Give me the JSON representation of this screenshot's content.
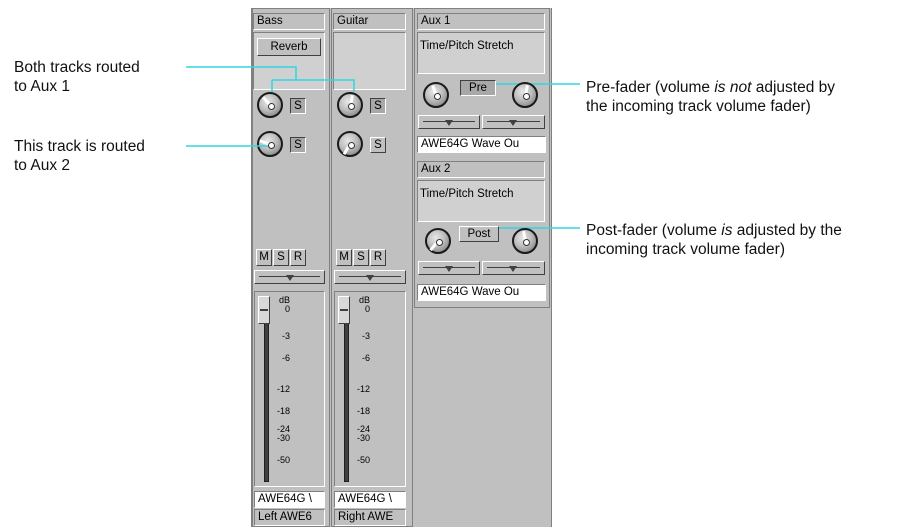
{
  "annotations": {
    "both_routed": [
      "Both tracks routed",
      "to Aux 1"
    ],
    "routed_aux2": [
      "This track is routed",
      "to Aux 2"
    ],
    "pre_fader": {
      "line1_pre": "Pre-fader (volume ",
      "line1_em": "is not",
      "line1_post": " adjusted by",
      "line2": "the incoming track volume fader)"
    },
    "post_fader": {
      "line1_pre": "Post-fader (volume ",
      "line1_em": "is",
      "line1_post": " adjusted by the",
      "line2": "incoming track volume fader)"
    }
  },
  "tracks": [
    {
      "name": "Bass",
      "effect": "Reverb",
      "solo": "S",
      "buttons": [
        "M",
        "S",
        "R"
      ],
      "output1": "AWE64G \\",
      "output2": "Left AWE6"
    },
    {
      "name": "Guitar",
      "effect": "",
      "solo": "S",
      "buttons": [
        "M",
        "S",
        "R"
      ],
      "output1": "AWE64G \\",
      "output2": "Right AWE"
    }
  ],
  "fader_scale": [
    "dB",
    "0",
    "-3",
    "-6",
    "-12",
    "-18",
    "-24",
    "-30",
    "-50"
  ],
  "aux_buses": [
    {
      "name": "Aux 1",
      "effect": "Time/Pitch Stretch",
      "mode": "Pre",
      "output": "AWE64G Wave Ou"
    },
    {
      "name": "Aux 2",
      "effect": "Time/Pitch Stretch",
      "mode": "Post",
      "output": "AWE64G Wave Ou"
    }
  ],
  "colors": {
    "panel": "#c0c0c0",
    "leader_line": "#33d6e0",
    "text": "#111111"
  }
}
